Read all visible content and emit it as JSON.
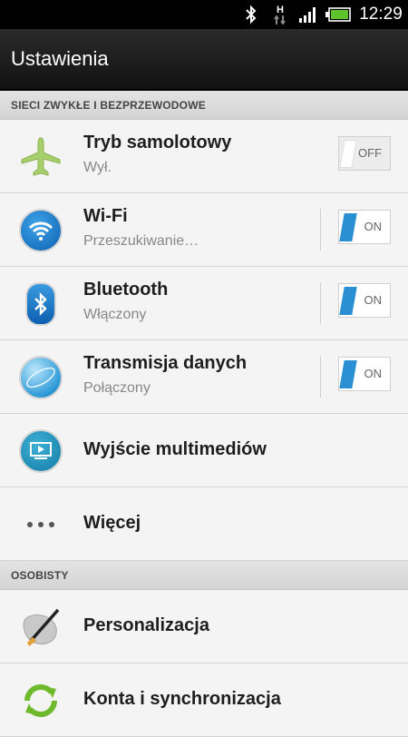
{
  "statusbar": {
    "time": "12:29",
    "network": "H",
    "icons": [
      "bluetooth-icon",
      "network-h-icon",
      "signal-icon",
      "battery-icon"
    ]
  },
  "header": {
    "title": "Ustawienia"
  },
  "sections": [
    {
      "title": "SIECI ZWYKŁE I BEZPRZEWODOWE"
    },
    {
      "title": "OSOBISTY"
    }
  ],
  "rows": [
    {
      "icon": "airplane-icon",
      "label": "Tryb samolotowy",
      "sub": "Wył.",
      "toggle": "OFF"
    },
    {
      "icon": "wifi-icon",
      "label": "Wi-Fi",
      "sub": "Przeszukiwanie…",
      "toggle": "ON"
    },
    {
      "icon": "bluetooth-icon",
      "label": "Bluetooth",
      "sub": "Włączony",
      "toggle": "ON"
    },
    {
      "icon": "globe-icon",
      "label": "Transmisja danych",
      "sub": "Połączony",
      "toggle": "ON"
    },
    {
      "icon": "media-output-icon",
      "label": "Wyjście multimediów"
    },
    {
      "icon": "more-dots-icon",
      "label": "Więcej"
    },
    {
      "icon": "paintbrush-icon",
      "label": "Personalizacja"
    },
    {
      "icon": "sync-icon",
      "label": "Konta i synchronizacja"
    }
  ],
  "colors": {
    "accent": "#2a8fd3",
    "wifi": "#1976c5",
    "sync": "#6fba2c"
  }
}
